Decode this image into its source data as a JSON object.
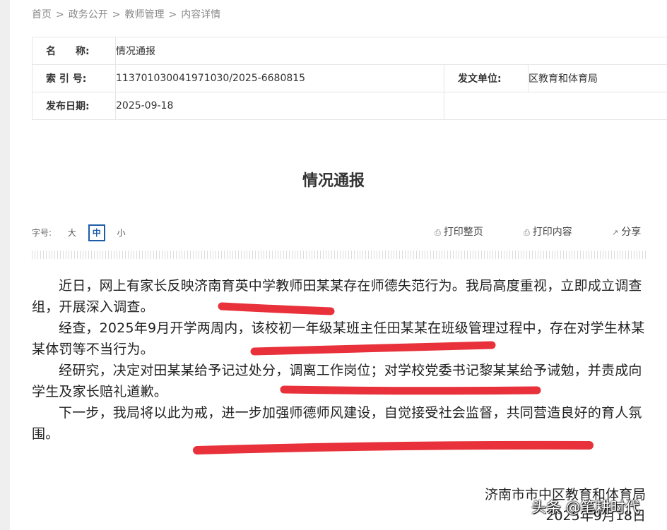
{
  "breadcrumb": {
    "items": [
      "首页",
      "政务公开",
      "教师管理",
      "内容详情"
    ],
    "separator": ">"
  },
  "meta": {
    "name_label": "名　　称:",
    "name_value": "情况通报",
    "index_label": "索 引 号:",
    "index_value": "113701030041971030/2025-6680815",
    "issuer_label": "发文单位:",
    "issuer_value": "区教育和体育局",
    "date_label": "发布日期:",
    "date_value": "2025-09-18"
  },
  "article": {
    "title": "情况通报",
    "paragraphs": [
      "近日，网上有家长反映济南育英中学教师田某某存在师德失范行为。我局高度重视，立即成立调查组，开展深入调查。",
      "经查，2025年9月开学两周内，该校初一年级某班主任田某某在班级管理过程中，存在对学生林某某体罚等不当行为。",
      "经研究，决定对田某某给予记过处分，调离工作岗位；对学校党委书记黎某某给予诫勉，并责成向学生及家长赔礼道歉。",
      "下一步，我局将以此为戒，进一步加强师德师风建设，自觉接受社会监督，共同营造良好的育人氛围。"
    ],
    "signature": "济南市市中区教育和体育局",
    "sign_date": "2025年9月18日"
  },
  "toolbar": {
    "font_size_label": "字号:",
    "sizes": [
      "大",
      "中",
      "小"
    ],
    "active_size": "中",
    "print_page": "打印整页",
    "print_content": "打印内容",
    "share": "分享"
  },
  "watermark": "头条 @笔耕时代",
  "colors": {
    "accent": "#1d5da8",
    "highlight": "#e8313a",
    "border": "#e6e6e6"
  },
  "icons": {
    "print": "printer-icon",
    "share": "share-icon"
  }
}
